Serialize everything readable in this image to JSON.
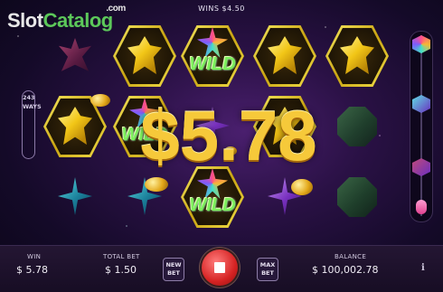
{
  "header": {
    "wins_text": "WINS $4.50"
  },
  "watermark": {
    "slot": "Slot",
    "catalog": "Catalog",
    "com": ".com"
  },
  "ways": {
    "number": "243",
    "label": "WAYS"
  },
  "big_win": {
    "amount": "$5.78"
  },
  "reels": {
    "symbols": [
      {
        "gem": "dark-red",
        "highlighted": false
      },
      {
        "gem": "yellow",
        "highlighted": true
      },
      {
        "gem": "teal",
        "highlighted": false
      },
      {
        "gem": "yellow",
        "highlighted": true
      },
      {
        "gem": "multi",
        "wild": "WILD",
        "highlighted": true
      },
      {
        "gem": "teal",
        "highlighted": false
      },
      {
        "gem": "multi",
        "wild": "WILD",
        "highlighted": true
      },
      {
        "gem": "purple",
        "highlighted": false
      },
      {
        "gem": "multi",
        "wild": "WILD",
        "highlighted": true
      },
      {
        "gem": "yellow",
        "highlighted": true
      },
      {
        "gem": "yellow",
        "highlighted": true
      },
      {
        "gem": "purple",
        "highlighted": false
      },
      {
        "gem": "yellow",
        "highlighted": true
      },
      {
        "gem": "green",
        "highlighted": false
      },
      {
        "gem": "green",
        "highlighted": false
      }
    ]
  },
  "bottom_bar": {
    "win_label": "WIN",
    "win_value": "$ 5.78",
    "total_bet_label": "TOTAL BET",
    "total_bet_value": "$ 1.50",
    "new_bet_label": "NEW BET",
    "max_bet_label": "MAX BET",
    "balance_label": "BALANCE",
    "balance_value": "$ 100,002.78",
    "info_label": "i"
  },
  "colors": {
    "gold": "#f6c93a",
    "wild_green": "#7cf05a",
    "stop_red": "#d62323"
  }
}
